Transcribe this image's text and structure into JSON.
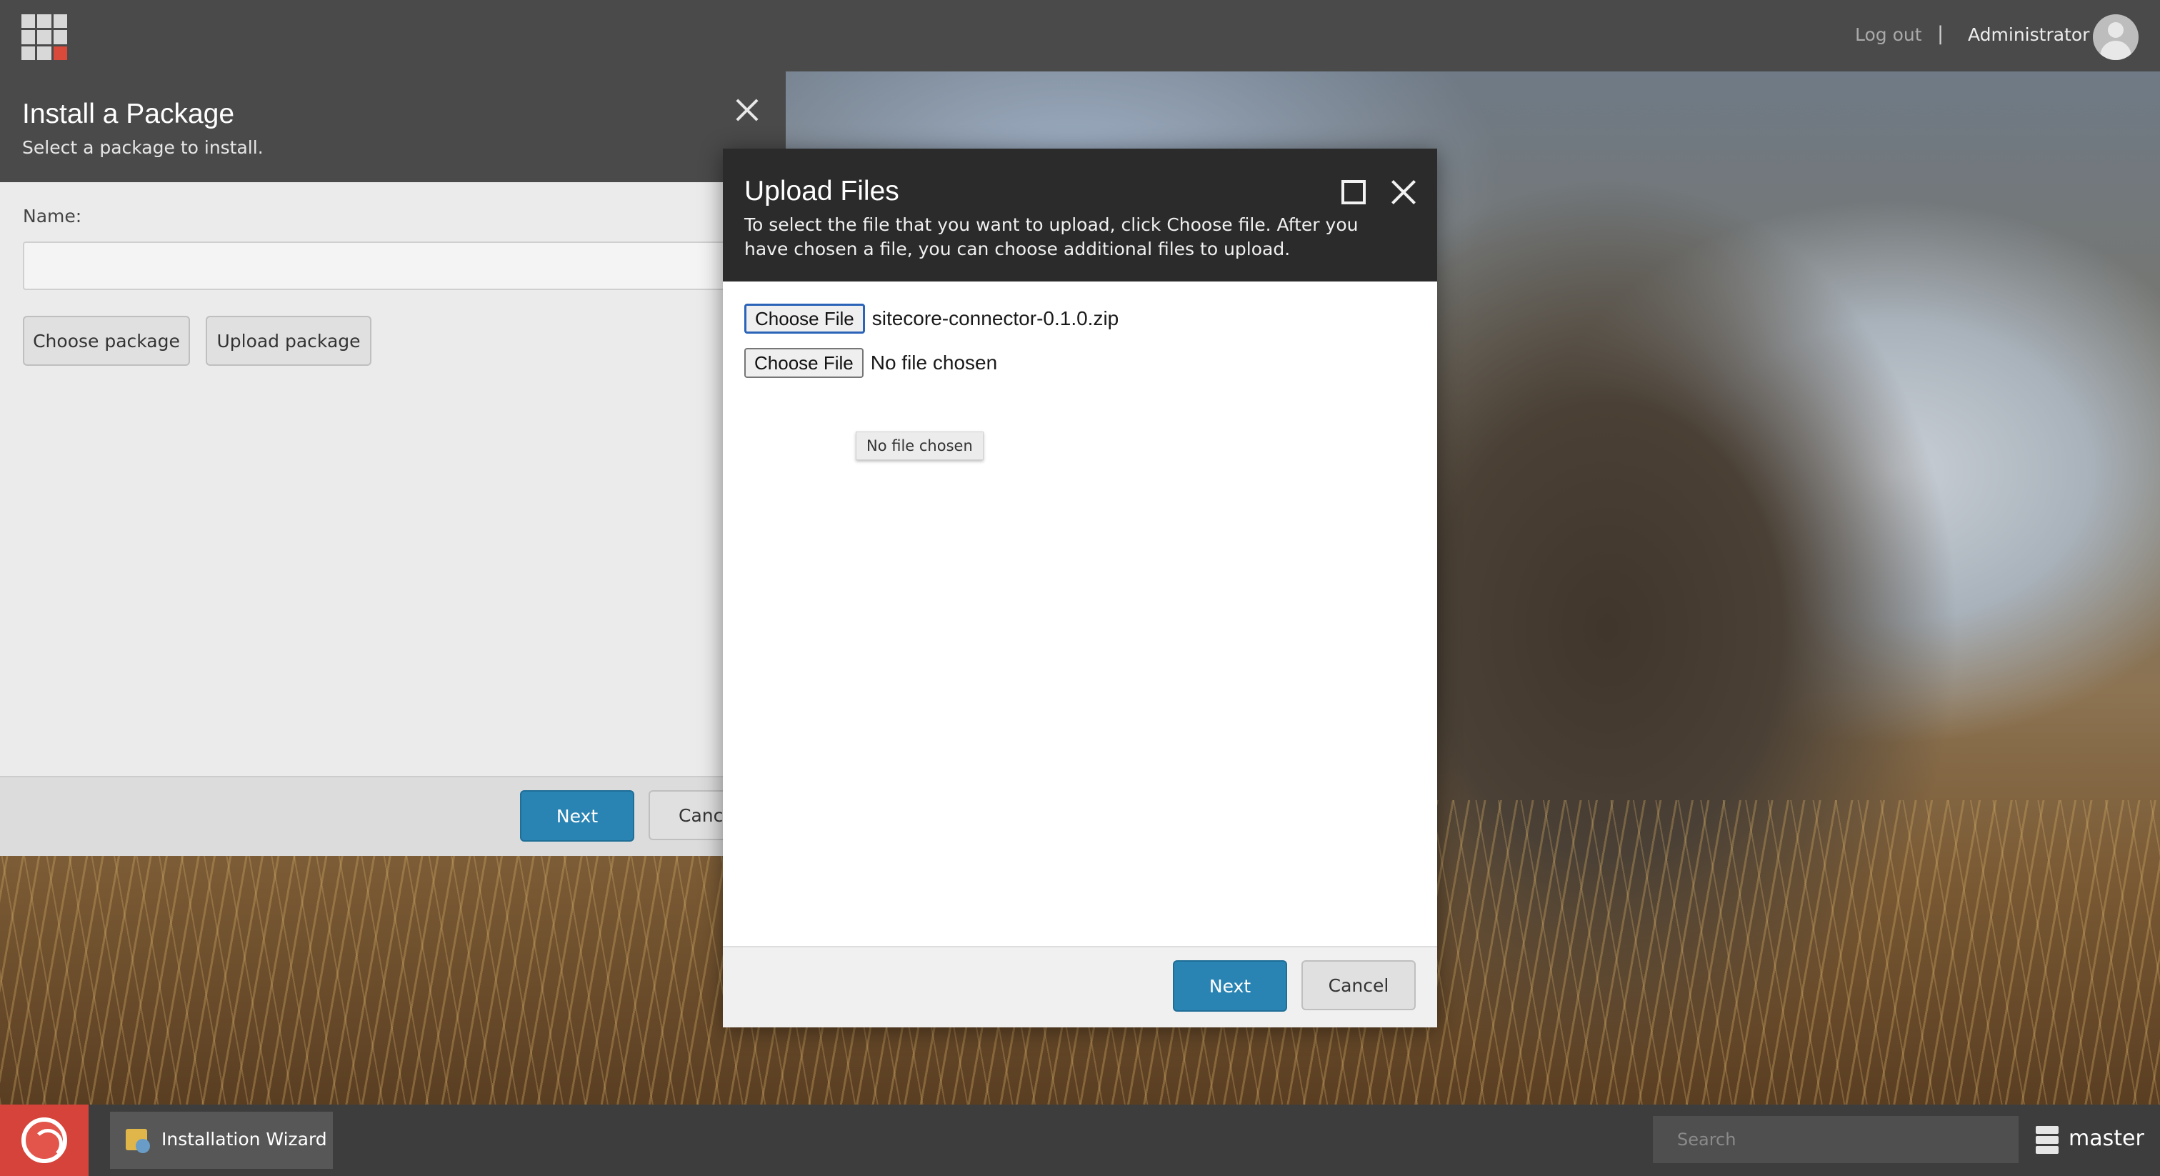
{
  "topbar": {
    "logout_label": "Log out",
    "separator": "|",
    "user_name": "Administrator"
  },
  "install_dialog": {
    "title": "Install a Package",
    "subtitle": "Select a package to install.",
    "name_label": "Name:",
    "name_value": "",
    "choose_package_label": "Choose package",
    "upload_package_label": "Upload package",
    "next_label": "Next",
    "cancel_label": "Cance"
  },
  "upload_dialog": {
    "title": "Upload Files",
    "description": "To select the file that you want to upload, click Choose file. After you have chosen a file, you can choose additional files to upload.",
    "files": [
      {
        "button_label": "Choose File",
        "file_name": "sitecore-connector-0.1.0.zip"
      },
      {
        "button_label": "Choose File",
        "file_name": "No file chosen"
      }
    ],
    "tooltip": "No file chosen",
    "next_label": "Next",
    "cancel_label": "Cancel"
  },
  "taskbar": {
    "task_label": "Installation Wizard",
    "search_placeholder": "Search",
    "database_label": "master"
  },
  "colors": {
    "primary_button": "#2a84b3",
    "start_tile": "#d6433a"
  }
}
